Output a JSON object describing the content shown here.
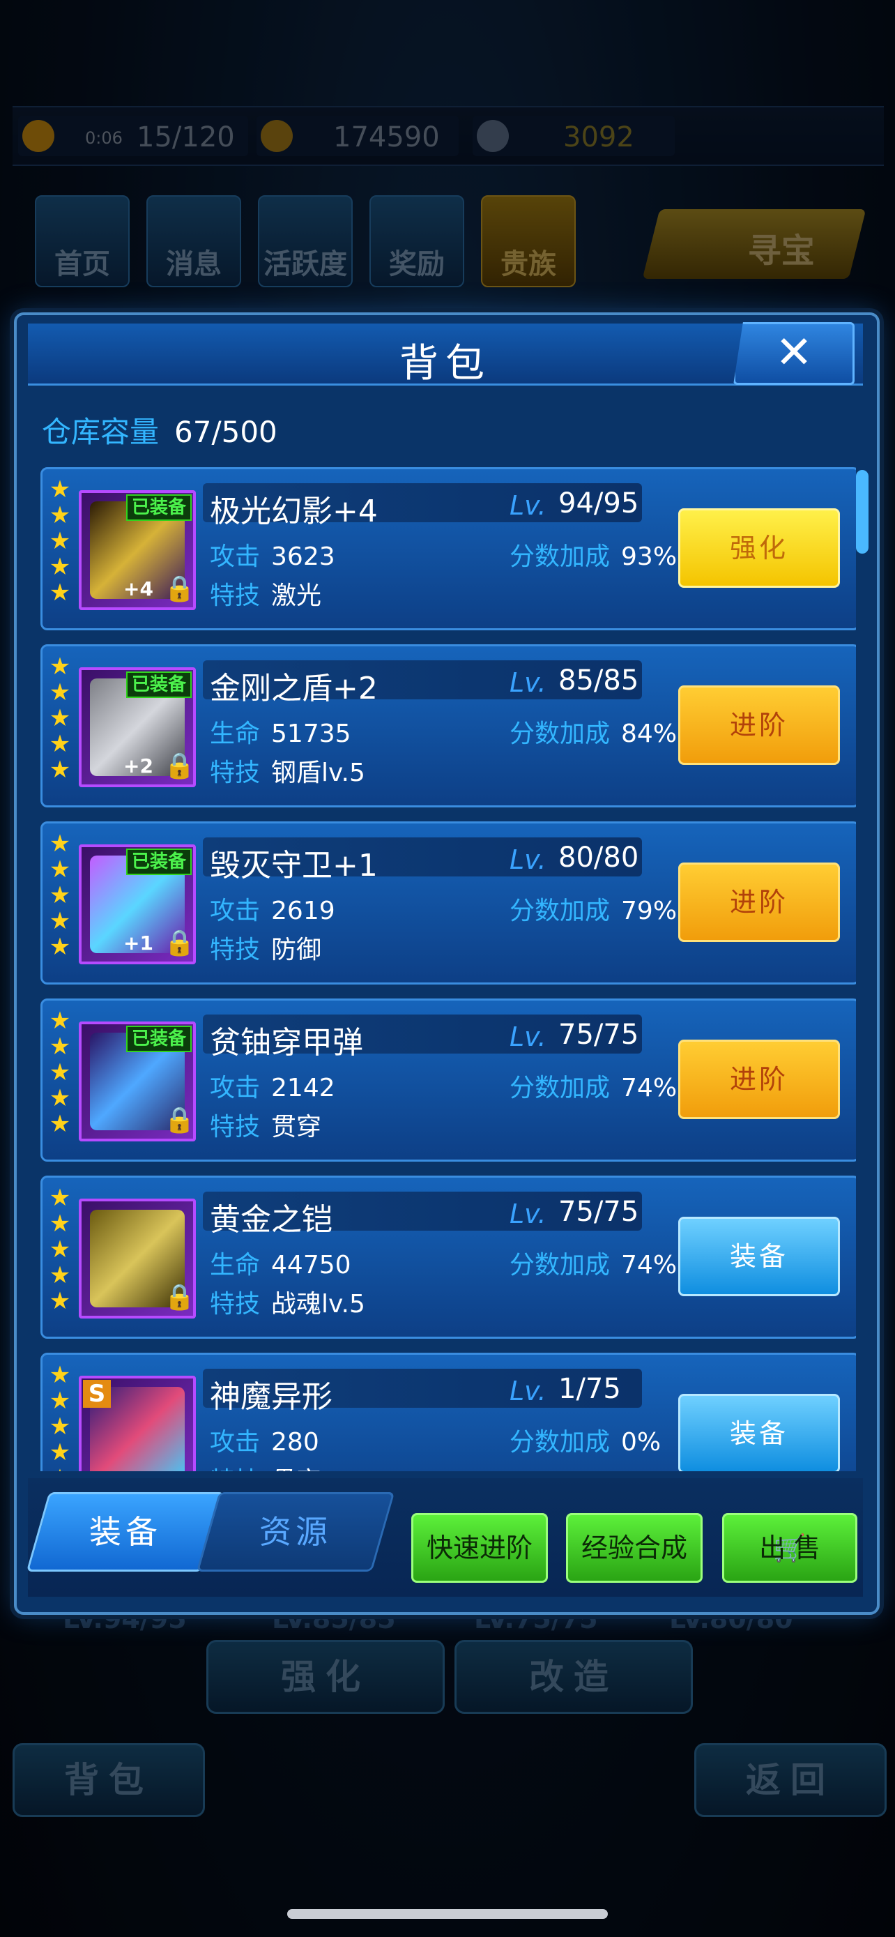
{
  "resources": {
    "energy_timer": "0:06",
    "energy": "15/120",
    "gold": "174590",
    "diamonds": "3092"
  },
  "nav": {
    "home": "首页",
    "messages": "消息",
    "activity": "活跃度",
    "rewards": "奖励",
    "noble": "贵族",
    "treasure": "寻宝"
  },
  "behind": {
    "levels": [
      "LV.94/95",
      "LV.85/85",
      "LV.75/75",
      "LV.80/80"
    ],
    "strengthen": "强化",
    "modify": "改造",
    "bag": "背包",
    "back": "返回"
  },
  "dialog": {
    "title": "背包",
    "close": "✕",
    "capacity_label": "仓库容量",
    "capacity_value": "67/500",
    "lv_label": "Lv.",
    "bonus_label": "分数加成",
    "skill_label": "特技",
    "equipped_label": "已装备",
    "items": [
      {
        "name": "极光幻影+4",
        "lv": "94/95",
        "stat_label": "攻击",
        "stat_value": "3623",
        "bonus": "93%",
        "skill": "激光",
        "plus": "+4",
        "action": "强化"
      },
      {
        "name": "金刚之盾+2",
        "lv": "85/85",
        "stat_label": "生命",
        "stat_value": "51735",
        "bonus": "84%",
        "skill": "钢盾lv.5",
        "plus": "+2",
        "action": "进阶"
      },
      {
        "name": "毁灭守卫+1",
        "lv": "80/80",
        "stat_label": "攻击",
        "stat_value": "2619",
        "bonus": "79%",
        "skill": "防御",
        "plus": "+1",
        "action": "进阶"
      },
      {
        "name": "贫铀穿甲弹",
        "lv": "75/75",
        "stat_label": "攻击",
        "stat_value": "2142",
        "bonus": "74%",
        "skill": "贯穿",
        "action": "进阶"
      },
      {
        "name": "黄金之铠",
        "lv": "75/75",
        "stat_label": "生命",
        "stat_value": "44750",
        "bonus": "74%",
        "skill": "战魂lv.5",
        "action": "装备"
      },
      {
        "name": "神魔异形",
        "lv": "1/75",
        "stat_label": "攻击",
        "stat_value": "280",
        "bonus": "0%",
        "skill": "贯穿",
        "badge": "S",
        "action": "装备"
      }
    ],
    "tabs": {
      "equipment": "装备",
      "resources": "资源"
    },
    "buttons": {
      "quick_advance": "快速进阶",
      "exp_synthesis": "经验合成",
      "sell": "出 售"
    }
  }
}
